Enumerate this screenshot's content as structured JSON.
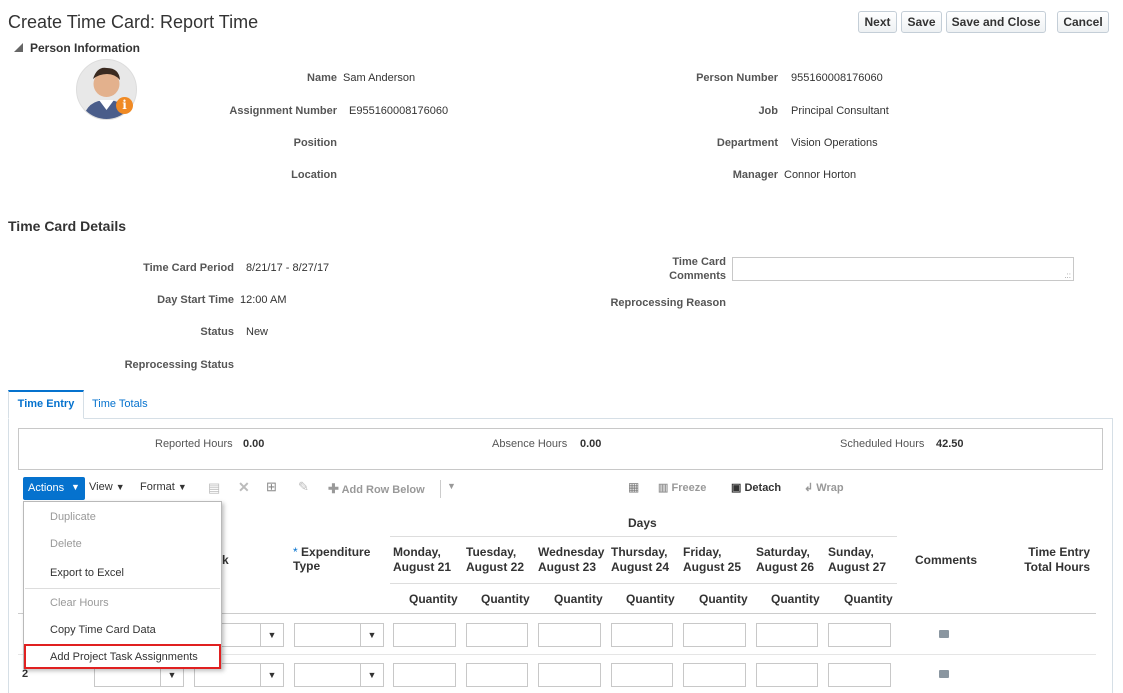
{
  "page": {
    "title": "Create Time Card: Report Time",
    "buttons": {
      "next": "Next",
      "save": "Save",
      "save_close": "Save and Close",
      "cancel": "Cancel"
    }
  },
  "person": {
    "section_title": "Person Information",
    "name_label": "Name",
    "name": "Sam Anderson",
    "assignment_label": "Assignment Number",
    "assignment": "E955160008176060",
    "position_label": "Position",
    "location_label": "Location",
    "person_number_label": "Person Number",
    "person_number": "955160008176060",
    "job_label": "Job",
    "job": "Principal Consultant",
    "department_label": "Department",
    "department": "Vision Operations",
    "manager_label": "Manager",
    "manager": "Connor Horton"
  },
  "details": {
    "section_title": "Time Card Details",
    "period_label": "Time Card Period",
    "period": "8/21/17 - 8/27/17",
    "day_start_label": "Day Start Time",
    "day_start": "12:00 AM",
    "status_label": "Status",
    "status": "New",
    "reprocessing_status_label": "Reprocessing Status",
    "comments_label_1": "Time Card",
    "comments_label_2": "Comments",
    "reprocessing_reason_label": "Reprocessing Reason"
  },
  "tabs": {
    "time_entry": "Time Entry",
    "time_totals": "Time Totals"
  },
  "summary": {
    "reported_label": "Reported Hours",
    "reported": "0.00",
    "absence_label": "Absence Hours",
    "absence": "0.00",
    "scheduled_label": "Scheduled Hours",
    "scheduled": "42.50"
  },
  "toolbar": {
    "actions": "Actions",
    "view": "View",
    "format": "Format",
    "add_row_below": "Add Row Below",
    "freeze": "Freeze",
    "detach": "Detach",
    "wrap": "Wrap"
  },
  "grid": {
    "days_label": "Days",
    "task_partial": "k",
    "expenditure_star": "*",
    "expenditure_1": "Expenditure",
    "expenditure_2": "Type",
    "days": [
      {
        "d1": "Monday,",
        "d2": "August 21"
      },
      {
        "d1": "Tuesday,",
        "d2": "August 22"
      },
      {
        "d1": "Wednesday",
        "d2": "August 23"
      },
      {
        "d1": "Thursday,",
        "d2": "August 24"
      },
      {
        "d1": "Friday,",
        "d2": "August 25"
      },
      {
        "d1": "Saturday,",
        "d2": "August 26"
      },
      {
        "d1": "Sunday,",
        "d2": "August 27"
      }
    ],
    "quantity": "Quantity",
    "comments": "Comments",
    "total_1": "Time Entry",
    "total_2": "Total Hours",
    "row2_num": "2"
  },
  "actions_menu": {
    "duplicate": "Duplicate",
    "delete": "Delete",
    "export": "Export to Excel",
    "clear": "Clear Hours",
    "copy": "Copy Time Card Data",
    "add_project": "Add Project Task Assignments"
  },
  "colors": {
    "accent": "#0572ce",
    "highlight": "#e02020",
    "panel_border": "#d6dfe6"
  }
}
